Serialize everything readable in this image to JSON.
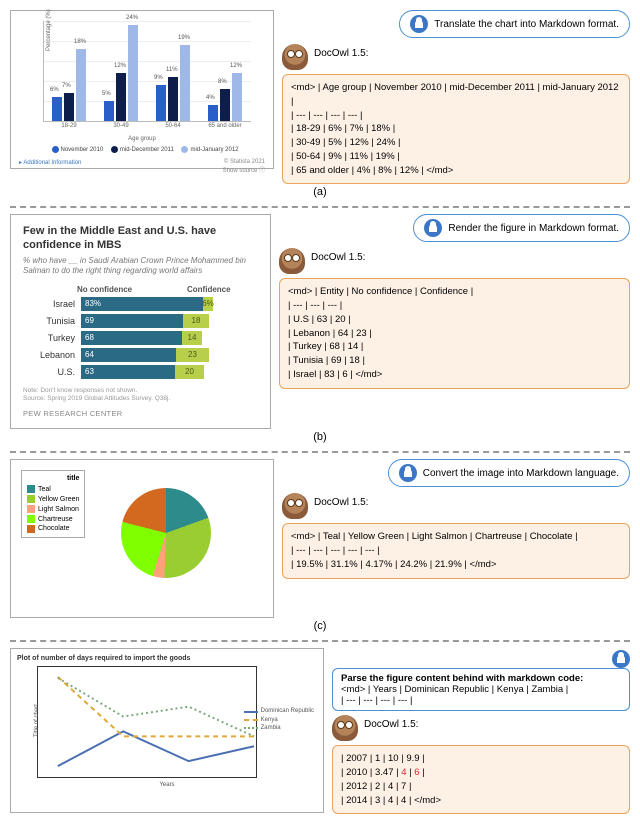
{
  "a": {
    "prompt": "Translate the chart into Markdown format.",
    "owl_label": "DocOwl 1.5:",
    "response": "<md> | Age group | November 2010 | mid-December 2011 | mid-January 2012 |\n| --- | --- | --- | --- |\n| 18-29 | 6% | 7% | 18% |\n| 30-49 | 5% | 12% | 24% |\n| 50-64 | 9% | 11% | 19% |\n| 65 and older | 4% | 8% | 12% | </md>",
    "label": "(a)"
  },
  "b": {
    "prompt": "Render the figure in Markdown format.",
    "owl_label": "DocOwl 1.5:",
    "response": "<md> | Entity | No confidence | Confidence |\n| --- | --- | --- |\n| U.S | 63 | 20 |\n| Lebanon | 64 | 23 |\n| Turkey | 68 | 14 |\n| Tunisia | 69 | 18 |\n| Israel | 83 | 6 | </md>",
    "label": "(b)"
  },
  "c": {
    "prompt": "Convert the image into Markdown language.",
    "owl_label": "DocOwl 1.5:",
    "response": "<md> | Teal | Yellow Green | Light Salmon | Chartreuse | Chocolate |\n| --- | --- | --- | --- | --- |\n| 19.5% | 31.1% | 4.17% | 24.2% | 21.9% | </md>",
    "label": "(c)"
  },
  "d": {
    "prompt_header": "Parse the figure content behind with markdown code:",
    "prompt_body": "<md> | Years | Dominican Republic | Kenya | Zambia |\n| --- | --- | --- | --- |",
    "owl_label": "DocOwl 1.5:",
    "response_plain": "| 2007 | 1 | 10 | 9.9 |\n| 2010 | 3.47 | ",
    "response_red1": "4",
    "response_mid": " | ",
    "response_red2": "6",
    "response_tail": " |\n| 2012 | 2 | 4 | 7 |\n| 2014 | 3 | 4 | 4 | </md>"
  },
  "chartA_meta": {
    "ylabel": "Percentage (%)",
    "xlabel": "Age group",
    "legend_s1": "November 2010",
    "legend_s2": "mid-December 2011",
    "legend_s3": "mid-January 2012",
    "addl": "▸ Additional Information",
    "src1": "© Statista 2021",
    "src2": "Show source ⓘ"
  },
  "chartB_meta": {
    "title": "Few in the Middle East and U.S. have confidence in MBS",
    "sub": "% who have __ in Saudi Arabian Crown Prince Mohammed bin Salman to do the right thing regarding world affairs",
    "h_nc": "No confidence",
    "h_cf": "Confidence",
    "note": "Note: Don't know responses not shown.\nSource: Spring 2019 Global Attitudes Survey. Q38j.",
    "org": "PEW RESEARCH CENTER"
  },
  "chartC_meta": {
    "legend_title": "title",
    "l1": "Teal",
    "l2": "Yellow Green",
    "l3": "Light Salmon",
    "l4": "Chartreuse",
    "l5": "Chocolate"
  },
  "chartD_meta": {
    "title": "Plot of number of days required to import the goods",
    "ylabel": "Title of chart",
    "xlabel": "Years",
    "leg1": "Dominican Republic",
    "leg2": "Kenya",
    "leg3": "Zambia"
  },
  "chart_data": [
    {
      "type": "bar",
      "title": "",
      "xlabel": "Age group",
      "ylabel": "Percentage (%)",
      "ylim": [
        0,
        25
      ],
      "categories": [
        "18-29",
        "30-49",
        "50-64",
        "65 and older"
      ],
      "series": [
        {
          "name": "November 2010",
          "values": [
            6,
            5,
            9,
            4
          ]
        },
        {
          "name": "mid-December 2011",
          "values": [
            7,
            12,
            11,
            8
          ]
        },
        {
          "name": "mid-January 2012",
          "values": [
            18,
            24,
            19,
            12
          ]
        }
      ]
    },
    {
      "type": "bar",
      "orientation": "horizontal",
      "title": "Few in the Middle East and U.S. have confidence in MBS",
      "categories": [
        "Israel",
        "Tunisia",
        "Turkey",
        "Lebanon",
        "U.S."
      ],
      "series": [
        {
          "name": "No confidence",
          "values": [
            83,
            69,
            68,
            64,
            63
          ]
        },
        {
          "name": "Confidence",
          "values": [
            6,
            18,
            14,
            23,
            20
          ]
        }
      ]
    },
    {
      "type": "pie",
      "title": "title",
      "categories": [
        "Teal",
        "Yellow Green",
        "Light Salmon",
        "Chartreuse",
        "Chocolate"
      ],
      "values": [
        19.5,
        31.1,
        4.17,
        24.2,
        21.9
      ],
      "colors": [
        "#2e8b8b",
        "#9acd32",
        "#ffa07a",
        "#7fff00",
        "#d2691e"
      ]
    },
    {
      "type": "line",
      "title": "Plot of number of days required to import the goods",
      "xlabel": "Years",
      "ylabel": "Title of chart",
      "x": [
        2007,
        2010,
        2012,
        2014
      ],
      "series": [
        {
          "name": "Dominican Republic",
          "values": [
            1,
            3.47,
            2,
            3
          ],
          "style": "solid",
          "color": "#4a6fb3"
        },
        {
          "name": "Kenya",
          "values": [
            10,
            4,
            4,
            4
          ],
          "style": "dashed",
          "color": "#e0a838"
        },
        {
          "name": "Zambia",
          "values": [
            9.9,
            6,
            7,
            4
          ],
          "style": "dotted",
          "color": "#7aa77a"
        }
      ]
    }
  ]
}
